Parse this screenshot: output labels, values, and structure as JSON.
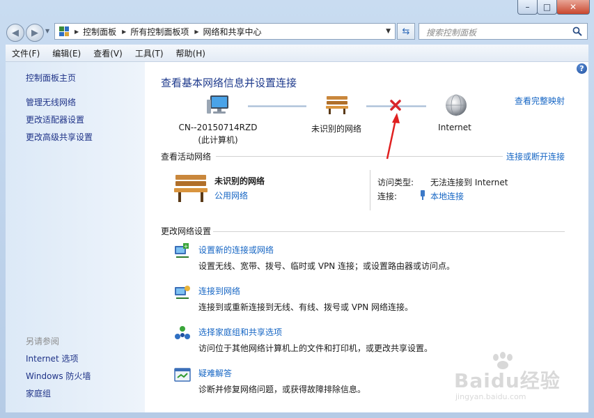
{
  "window": {
    "min_label": "–",
    "max_label": "□",
    "close_label": "✕"
  },
  "nav": {
    "breadcrumbs": [
      "控制面板",
      "所有控制面板项",
      "网络和共享中心"
    ],
    "search_placeholder": "搜索控制面板"
  },
  "menu": [
    "文件(F)",
    "编辑(E)",
    "查看(V)",
    "工具(T)",
    "帮助(H)"
  ],
  "sidebar": {
    "links": [
      "控制面板主页",
      "管理无线网络",
      "更改适配器设置",
      "更改高级共享设置"
    ],
    "see_also_heading": "另请参阅",
    "see_also": [
      "Internet 选项",
      "Windows 防火墙",
      "家庭组"
    ]
  },
  "main": {
    "title": "查看基本网络信息并设置连接",
    "full_map_link": "查看完整映射",
    "computer_name": "CN--20150714RZD",
    "computer_sub": "(此计算机)",
    "network_node": "未识别的网络",
    "internet_node": "Internet",
    "active_title": "查看活动网络",
    "connect_link": "连接或断开连接",
    "active_network": {
      "name": "未识别的网络",
      "type": "公用网络",
      "access_label": "访问类型:",
      "access_value": "无法连接到 Internet",
      "conn_label": "连接:",
      "conn_value": "本地连接"
    },
    "change_title": "更改网络设置",
    "tasks": [
      {
        "title": "设置新的连接或网络",
        "desc": "设置无线、宽带、拨号、临时或 VPN 连接；或设置路由器或访问点。"
      },
      {
        "title": "连接到网络",
        "desc": "连接到或重新连接到无线、有线、拨号或 VPN 网络连接。"
      },
      {
        "title": "选择家庭组和共享选项",
        "desc": "访问位于其他网络计算机上的文件和打印机，或更改共享设置。"
      },
      {
        "title": "疑难解答",
        "desc": "诊断并修复网络问题，或获得故障排除信息。"
      }
    ]
  },
  "watermark": {
    "brand": "Baidu经验",
    "url": "jingyan.baidu.com"
  },
  "colors": {
    "link": "#1666c4",
    "title": "#1e3a8c",
    "error_x": "#d8262b",
    "arrow": "#e02020"
  }
}
